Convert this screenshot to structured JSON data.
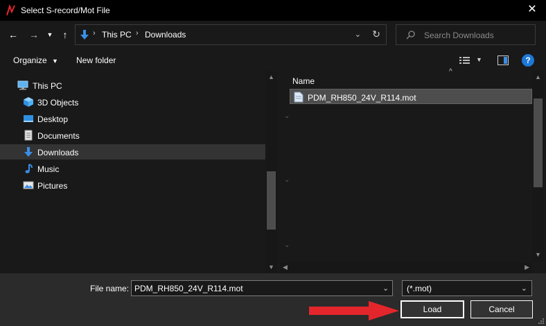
{
  "window": {
    "title": "Select S-record/Mot File"
  },
  "nav": {
    "breadcrumbs": [
      "This PC",
      "Downloads"
    ],
    "search_placeholder": "Search Downloads"
  },
  "toolbar": {
    "organize_label": "Organize",
    "new_folder_label": "New folder"
  },
  "sidebar": {
    "items": [
      {
        "label": "This PC",
        "icon": "computer-icon"
      },
      {
        "label": "3D Objects",
        "icon": "cube-icon"
      },
      {
        "label": "Desktop",
        "icon": "desktop-icon"
      },
      {
        "label": "Documents",
        "icon": "document-icon"
      },
      {
        "label": "Downloads",
        "icon": "download-arrow-icon",
        "selected": true
      },
      {
        "label": "Music",
        "icon": "music-note-icon"
      },
      {
        "label": "Pictures",
        "icon": "picture-icon"
      }
    ]
  },
  "file_list": {
    "column_header": "Name",
    "files": [
      {
        "name": "PDM_RH850_24V_R114.mot",
        "selected": true
      }
    ]
  },
  "footer": {
    "file_name_label": "File name:",
    "file_name_value": "PDM_RH850_24V_R114.mot",
    "file_type_value": "(*.mot)",
    "load_label": "Load",
    "cancel_label": "Cancel"
  },
  "colors": {
    "accent_blue": "#1e78d7",
    "annotation_red": "#e3262b"
  }
}
